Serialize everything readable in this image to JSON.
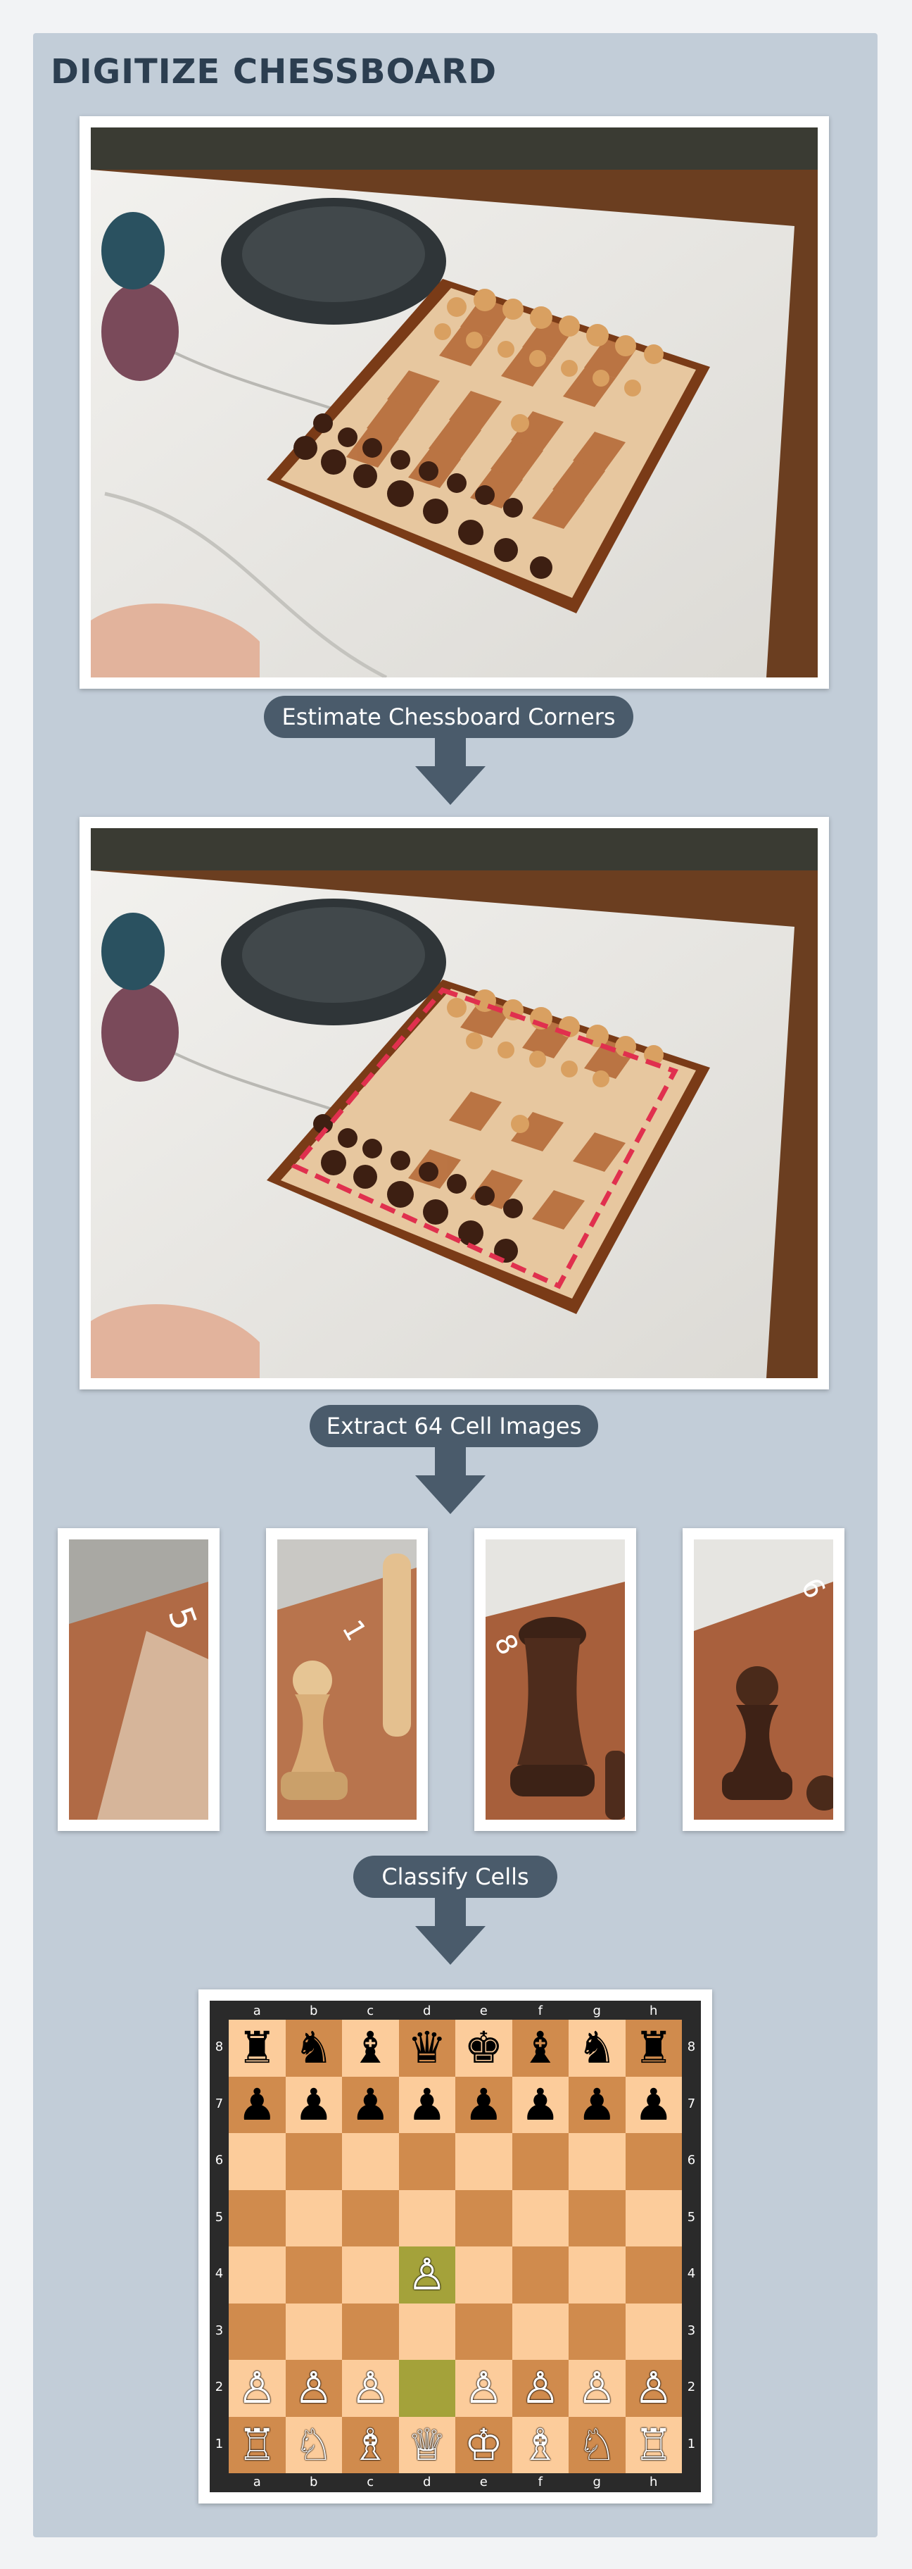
{
  "title": "DIGITIZE CHESSBOARD",
  "steps": {
    "step1": "Estimate Chessboard Corners",
    "step2": "Extract 64 Cell Images",
    "step3": "Classify Cells"
  },
  "cell_labels": [
    "5",
    "1",
    "8",
    "6"
  ],
  "board": {
    "files": [
      "a",
      "b",
      "c",
      "d",
      "e",
      "f",
      "g",
      "h"
    ],
    "ranks": [
      "8",
      "7",
      "6",
      "5",
      "4",
      "3",
      "2",
      "1"
    ],
    "highlight_squares": [
      "d4",
      "d2"
    ],
    "position": [
      [
        "♜",
        "♞",
        "♝",
        "♛",
        "♚",
        "♝",
        "♞",
        "♜"
      ],
      [
        "♟",
        "♟",
        "♟",
        "♟",
        "♟",
        "♟",
        "♟",
        "♟"
      ],
      [
        "",
        "",
        "",
        "",
        "",
        "",
        "",
        ""
      ],
      [
        "",
        "",
        "",
        "",
        "",
        "",
        "",
        ""
      ],
      [
        "",
        "",
        "",
        "♙",
        "",
        "",
        "",
        ""
      ],
      [
        "",
        "",
        "",
        "",
        "",
        "",
        "",
        ""
      ],
      [
        "♙",
        "♙",
        "♙",
        "",
        "♙",
        "♙",
        "♙",
        "♙"
      ],
      [
        "♖",
        "♘",
        "♗",
        "♕",
        "♔",
        "♗",
        "♘",
        "♖"
      ]
    ]
  },
  "colors": {
    "panel": "#c2cdd8",
    "pill": "#4a5b6b",
    "corner_outline": "#e0304e",
    "light_square": "#fccc9b",
    "dark_square": "#d08b4d",
    "highlight": "#a4a23a"
  }
}
